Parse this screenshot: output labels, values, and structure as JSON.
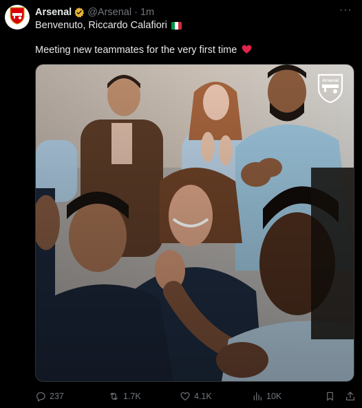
{
  "post": {
    "author_name": "Arsenal",
    "handle": "@Arsenal",
    "separator": "·",
    "time": "1m",
    "subtitle": "Benvenuto, Riccardo Calafiori",
    "text": "Meeting new teammates for the very first time",
    "more_label": "···",
    "media_watermark": "Arsenal"
  },
  "actions": {
    "replies": "237",
    "reposts": "1.7K",
    "likes": "4.1K",
    "views": "10K"
  },
  "icons": {
    "avatar": "arsenal-crest-icon",
    "verified": "verified-badge-icon",
    "flag": "italy-flag-icon",
    "heart_emoji": "red-heart-icon",
    "reply": "reply-icon",
    "repost": "repost-icon",
    "like": "like-icon",
    "views": "views-icon",
    "bookmark": "bookmark-icon",
    "share": "share-icon"
  },
  "colors": {
    "background": "#000000",
    "text": "#e7e9ea",
    "muted": "#71767b",
    "verified_gold": "#e8b339",
    "heart": "#f91880",
    "arsenal_red": "#db0007",
    "flag_green": "#009246",
    "flag_white": "#ffffff",
    "flag_red": "#ce2b37"
  }
}
